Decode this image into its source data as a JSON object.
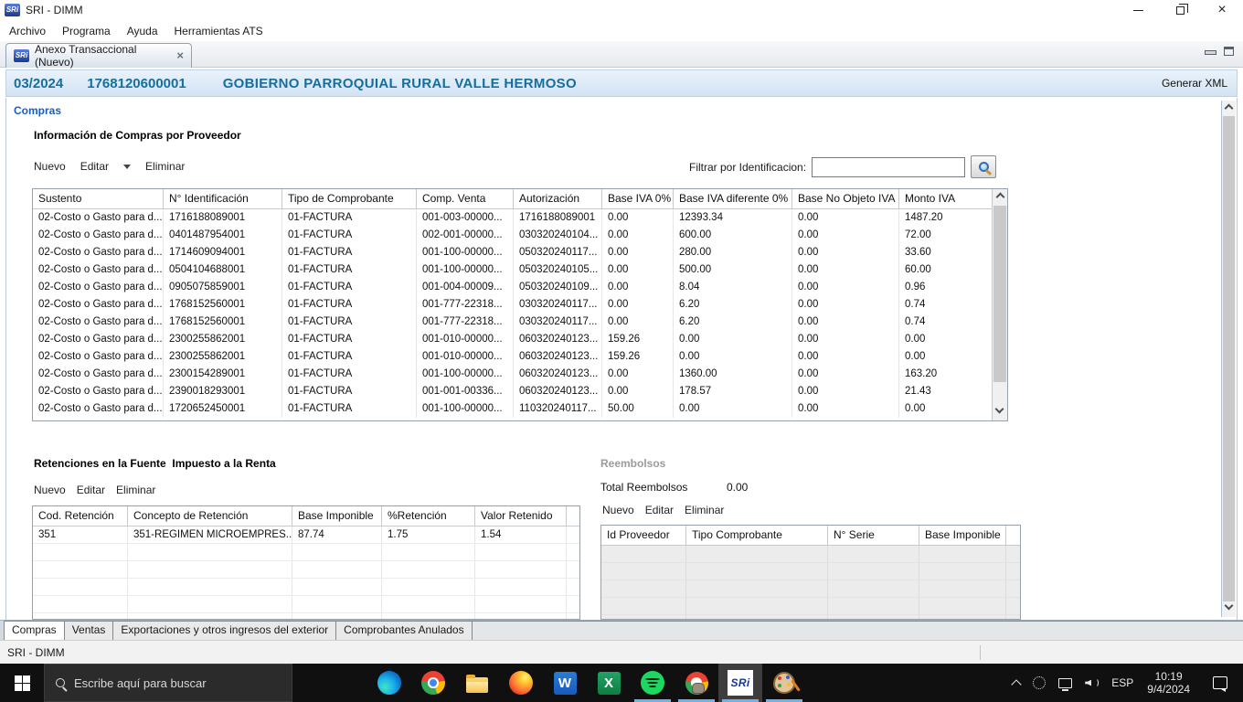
{
  "window": {
    "title": "SRI - DIMM"
  },
  "menu": {
    "items": [
      "Archivo",
      "Programa",
      "Ayuda",
      "Herramientas ATS"
    ]
  },
  "editor_tab": {
    "label": "Anexo Transaccional (Nuevo)"
  },
  "header": {
    "period": "03/2024",
    "ruc": "1768120600001",
    "taxpayer": "GOBIERNO PARROQUIAL RURAL VALLE HERMOSO",
    "generate_button": "Generar XML"
  },
  "compras": {
    "section_label": "Compras",
    "subtitle": "Información de Compras por Proveedor",
    "toolbar": {
      "nuevo": "Nuevo",
      "editar": "Editar",
      "eliminar": "Eliminar"
    },
    "filter": {
      "label": "Filtrar por Identificacion:",
      "value": ""
    },
    "table": {
      "columns": [
        "Sustento",
        "N° Identificación",
        "Tipo de Comprobante",
        "Comp. Venta",
        "Autorización",
        "Base IVA 0%",
        "Base IVA diferente 0%",
        "Base No Objeto IVA",
        "Monto IVA"
      ],
      "rows": [
        [
          "02-Costo o Gasto para d...",
          "1716188089001",
          "01-FACTURA",
          "001-003-00000...",
          "1716188089001",
          "0.00",
          "12393.34",
          "0.00",
          "1487.20"
        ],
        [
          "02-Costo o Gasto para d...",
          "0401487954001",
          "01-FACTURA",
          "002-001-00000...",
          "030320240104...",
          "0.00",
          "600.00",
          "0.00",
          "72.00"
        ],
        [
          "02-Costo o Gasto para d...",
          "1714609094001",
          "01-FACTURA",
          "001-100-00000...",
          "050320240117...",
          "0.00",
          "280.00",
          "0.00",
          "33.60"
        ],
        [
          "02-Costo o Gasto para d...",
          "0504104688001",
          "01-FACTURA",
          "001-100-00000...",
          "050320240105...",
          "0.00",
          "500.00",
          "0.00",
          "60.00"
        ],
        [
          "02-Costo o Gasto para d...",
          "0905075859001",
          "01-FACTURA",
          "001-004-00009...",
          "050320240109...",
          "0.00",
          "8.04",
          "0.00",
          "0.96"
        ],
        [
          "02-Costo o Gasto para d...",
          "1768152560001",
          "01-FACTURA",
          "001-777-22318...",
          "030320240117...",
          "0.00",
          "6.20",
          "0.00",
          "0.74"
        ],
        [
          "02-Costo o Gasto para d...",
          "1768152560001",
          "01-FACTURA",
          "001-777-22318...",
          "030320240117...",
          "0.00",
          "6.20",
          "0.00",
          "0.74"
        ],
        [
          "02-Costo o Gasto para d...",
          "2300255862001",
          "01-FACTURA",
          "001-010-00000...",
          "060320240123...",
          "159.26",
          "0.00",
          "0.00",
          "0.00"
        ],
        [
          "02-Costo o Gasto para d...",
          "2300255862001",
          "01-FACTURA",
          "001-010-00000...",
          "060320240123...",
          "159.26",
          "0.00",
          "0.00",
          "0.00"
        ],
        [
          "02-Costo o Gasto para d...",
          "2300154289001",
          "01-FACTURA",
          "001-100-00000...",
          "060320240123...",
          "0.00",
          "1360.00",
          "0.00",
          "163.20"
        ],
        [
          "02-Costo o Gasto para d...",
          "2390018293001",
          "01-FACTURA",
          "001-001-00336...",
          "060320240123...",
          "0.00",
          "178.57",
          "0.00",
          "21.43"
        ],
        [
          "02-Costo o Gasto para d...",
          "1720652450001",
          "01-FACTURA",
          "001-100-00000...",
          "110320240117...",
          "50.00",
          "0.00",
          "0.00",
          "0.00"
        ]
      ]
    }
  },
  "retenciones": {
    "title": "Retenciones en la Fuente  Impuesto a la Renta",
    "toolbar": {
      "nuevo": "Nuevo",
      "editar": "Editar",
      "eliminar": "Eliminar"
    },
    "table": {
      "columns": [
        "Cod. Retención",
        "Concepto de Retención",
        "Base Imponible",
        "%Retención",
        "Valor Retenido",
        ""
      ],
      "rows": [
        [
          "351",
          "351-REGIMEN MICROEMPRES...",
          "87.74",
          "1.75",
          "1.54",
          ""
        ]
      ]
    }
  },
  "reembolsos": {
    "title": "Reembolsos",
    "total_label": "Total Reembolsos",
    "total_value": "0.00",
    "toolbar": {
      "nuevo": "Nuevo",
      "editar": "Editar",
      "eliminar": "Eliminar"
    },
    "table": {
      "columns": [
        "Id Proveedor",
        "Tipo Comprobante",
        "N° Serie",
        "Base Imponible",
        ""
      ]
    }
  },
  "bottom_tabs": {
    "items": [
      {
        "label": "Compras",
        "active": true
      },
      {
        "label": "Ventas",
        "active": false
      },
      {
        "label": "Exportaciones y otros ingresos del exterior",
        "active": false
      },
      {
        "label": "Comprobantes Anulados",
        "active": false
      }
    ]
  },
  "status_bar": {
    "text": "SRI - DIMM"
  },
  "taskbar": {
    "search_placeholder": "Escribe aquí para buscar",
    "apps": [
      "edge",
      "chrome",
      "file-explorer",
      "firefox",
      "word",
      "excel",
      "spotify",
      "chrome-alt",
      "sri-dimm",
      "paint"
    ],
    "word_letter": "W",
    "excel_letter": "X",
    "sri_logo_text": "SRi",
    "tray": {
      "language": "ESP",
      "time": "10:19",
      "date": "9/4/2024"
    }
  },
  "colors": {
    "header_text": "#156f9e",
    "section_label": "#155ec4",
    "running_underline": "#6cb3e8"
  }
}
